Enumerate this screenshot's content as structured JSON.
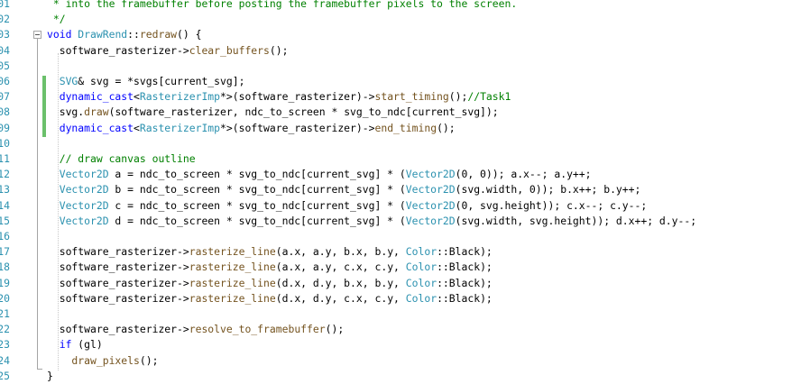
{
  "editor": {
    "lines": [
      {
        "n": "01",
        "tokens": [
          {
            "t": " * into the framebuffer before posting the framebuffer pixels to the screen.",
            "c": "cm"
          }
        ]
      },
      {
        "n": "02",
        "tokens": [
          {
            "t": " */",
            "c": "cm"
          }
        ]
      },
      {
        "n": "03",
        "fold": true,
        "tokens": [
          {
            "t": "void",
            "c": "kw"
          },
          {
            "t": " ",
            "c": "plain"
          },
          {
            "t": "DrawRend",
            "c": "ty"
          },
          {
            "t": "::",
            "c": "plain"
          },
          {
            "t": "redraw",
            "c": "fn"
          },
          {
            "t": "() {",
            "c": "plain"
          }
        ]
      },
      {
        "n": "04",
        "tokens": [
          {
            "t": "  software_rasterizer->",
            "c": "plain"
          },
          {
            "t": "clear_buffers",
            "c": "fn"
          },
          {
            "t": "();",
            "c": "plain"
          }
        ]
      },
      {
        "n": "05",
        "tokens": []
      },
      {
        "n": "06",
        "tokens": [
          {
            "t": "  SVG",
            "c": "ty"
          },
          {
            "t": "& svg = *svgs[current_svg];",
            "c": "plain"
          }
        ]
      },
      {
        "n": "07",
        "tokens": [
          {
            "t": "  dynamic_cast",
            "c": "kw"
          },
          {
            "t": "<",
            "c": "plain"
          },
          {
            "t": "RasterizerImp",
            "c": "ty"
          },
          {
            "t": "*>(software_rasterizer)->",
            "c": "plain"
          },
          {
            "t": "start_timing",
            "c": "fn"
          },
          {
            "t": "();",
            "c": "plain"
          },
          {
            "t": "//Task1",
            "c": "cm"
          }
        ]
      },
      {
        "n": "08",
        "tokens": [
          {
            "t": "  svg.",
            "c": "plain"
          },
          {
            "t": "draw",
            "c": "fn"
          },
          {
            "t": "(software_rasterizer, ndc_to_screen * svg_to_ndc[current_svg]);",
            "c": "plain"
          }
        ]
      },
      {
        "n": "09",
        "tokens": [
          {
            "t": "  dynamic_cast",
            "c": "kw"
          },
          {
            "t": "<",
            "c": "plain"
          },
          {
            "t": "RasterizerImp",
            "c": "ty"
          },
          {
            "t": "*>(software_rasterizer)->",
            "c": "plain"
          },
          {
            "t": "end_timing",
            "c": "fn"
          },
          {
            "t": "();",
            "c": "plain"
          }
        ]
      },
      {
        "n": "10",
        "tokens": []
      },
      {
        "n": "11",
        "tokens": [
          {
            "t": "  // draw canvas outline",
            "c": "cm"
          }
        ]
      },
      {
        "n": "12",
        "tokens": [
          {
            "t": "  Vector2D",
            "c": "ty"
          },
          {
            "t": " a = ndc_to_screen * svg_to_ndc[current_svg] * (",
            "c": "plain"
          },
          {
            "t": "Vector2D",
            "c": "ty"
          },
          {
            "t": "(0, 0)); a.x--; a.y++;",
            "c": "plain"
          }
        ]
      },
      {
        "n": "13",
        "tokens": [
          {
            "t": "  Vector2D",
            "c": "ty"
          },
          {
            "t": " b = ndc_to_screen * svg_to_ndc[current_svg] * (",
            "c": "plain"
          },
          {
            "t": "Vector2D",
            "c": "ty"
          },
          {
            "t": "(svg.width, 0)); b.x++; b.y++;",
            "c": "plain"
          }
        ]
      },
      {
        "n": "14",
        "tokens": [
          {
            "t": "  Vector2D",
            "c": "ty"
          },
          {
            "t": " c = ndc_to_screen * svg_to_ndc[current_svg] * (",
            "c": "plain"
          },
          {
            "t": "Vector2D",
            "c": "ty"
          },
          {
            "t": "(0, svg.height)); c.x--; c.y--;",
            "c": "plain"
          }
        ]
      },
      {
        "n": "15",
        "tokens": [
          {
            "t": "  Vector2D",
            "c": "ty"
          },
          {
            "t": " d = ndc_to_screen * svg_to_ndc[current_svg] * (",
            "c": "plain"
          },
          {
            "t": "Vector2D",
            "c": "ty"
          },
          {
            "t": "(svg.width, svg.height)); d.x++; d.y--;",
            "c": "plain"
          }
        ]
      },
      {
        "n": "16",
        "tokens": []
      },
      {
        "n": "17",
        "tokens": [
          {
            "t": "  software_rasterizer->",
            "c": "plain"
          },
          {
            "t": "rasterize_line",
            "c": "fn"
          },
          {
            "t": "(a.x, a.y, b.x, b.y, ",
            "c": "plain"
          },
          {
            "t": "Color",
            "c": "ty"
          },
          {
            "t": "::Black);",
            "c": "plain"
          }
        ]
      },
      {
        "n": "18",
        "tokens": [
          {
            "t": "  software_rasterizer->",
            "c": "plain"
          },
          {
            "t": "rasterize_line",
            "c": "fn"
          },
          {
            "t": "(a.x, a.y, c.x, c.y, ",
            "c": "plain"
          },
          {
            "t": "Color",
            "c": "ty"
          },
          {
            "t": "::Black);",
            "c": "plain"
          }
        ]
      },
      {
        "n": "19",
        "tokens": [
          {
            "t": "  software_rasterizer->",
            "c": "plain"
          },
          {
            "t": "rasterize_line",
            "c": "fn"
          },
          {
            "t": "(d.x, d.y, b.x, b.y, ",
            "c": "plain"
          },
          {
            "t": "Color",
            "c": "ty"
          },
          {
            "t": "::Black);",
            "c": "plain"
          }
        ]
      },
      {
        "n": "20",
        "tokens": [
          {
            "t": "  software_rasterizer->",
            "c": "plain"
          },
          {
            "t": "rasterize_line",
            "c": "fn"
          },
          {
            "t": "(d.x, d.y, c.x, c.y, ",
            "c": "plain"
          },
          {
            "t": "Color",
            "c": "ty"
          },
          {
            "t": "::Black);",
            "c": "plain"
          }
        ]
      },
      {
        "n": "21",
        "tokens": []
      },
      {
        "n": "22",
        "tokens": [
          {
            "t": "  software_rasterizer->",
            "c": "plain"
          },
          {
            "t": "resolve_to_framebuffer",
            "c": "fn"
          },
          {
            "t": "();",
            "c": "plain"
          }
        ]
      },
      {
        "n": "23",
        "tokens": [
          {
            "t": "  if",
            "c": "kw"
          },
          {
            "t": " (gl)",
            "c": "plain"
          }
        ]
      },
      {
        "n": "24",
        "tokens": [
          {
            "t": "    draw_pixels",
            "c": "fn"
          },
          {
            "t": "();",
            "c": "plain"
          }
        ]
      },
      {
        "n": "25",
        "tokens": [
          {
            "t": "}",
            "c": "plain"
          }
        ]
      }
    ],
    "colors": {
      "keyword": "#0000ff",
      "comment": "#008000",
      "type": "#2b91af",
      "function": "#74531f",
      "line_number": "#2b91af",
      "change_bar": "#6bc06b"
    }
  }
}
